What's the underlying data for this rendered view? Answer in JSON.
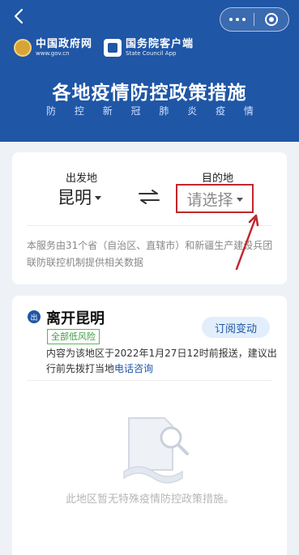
{
  "header": {
    "gov_cn": "中国政府网",
    "gov_en": "www.gov.cn",
    "app_cn": "国务院客户端",
    "app_en": "State Council App",
    "title": "各地疫情防控政策措施",
    "subtitle": [
      "防",
      "控",
      "新",
      "冠",
      "肺",
      "炎",
      "疫",
      "情"
    ]
  },
  "route": {
    "origin_label": "出发地",
    "origin_value": "昆明",
    "dest_label": "目的地",
    "dest_placeholder": "请选择",
    "notice": "本服务由31个省（自治区、直辖市）和新疆生产建设兵团联防联控机制提供相关数据"
  },
  "leave": {
    "icon_text": "出",
    "title": "离开昆明",
    "risk": "全部低风险",
    "subscribe": "订阅变动",
    "info": "内容为该地区于2022年1月27日12时前报送，建议出行前先拨打当地",
    "link": "电话咨询",
    "empty": "此地区暂无特殊疫情防控政策措施。"
  },
  "colors": {
    "brand_blue": "#1f56a6",
    "highlight_red": "#c1272d",
    "risk_green": "#3f9b43"
  },
  "icons": [
    "back-icon",
    "more-icon",
    "close-icon",
    "gov-emblem-icon",
    "app-logo-icon",
    "swap-icon",
    "dropdown-icon",
    "document-search-icon"
  ]
}
